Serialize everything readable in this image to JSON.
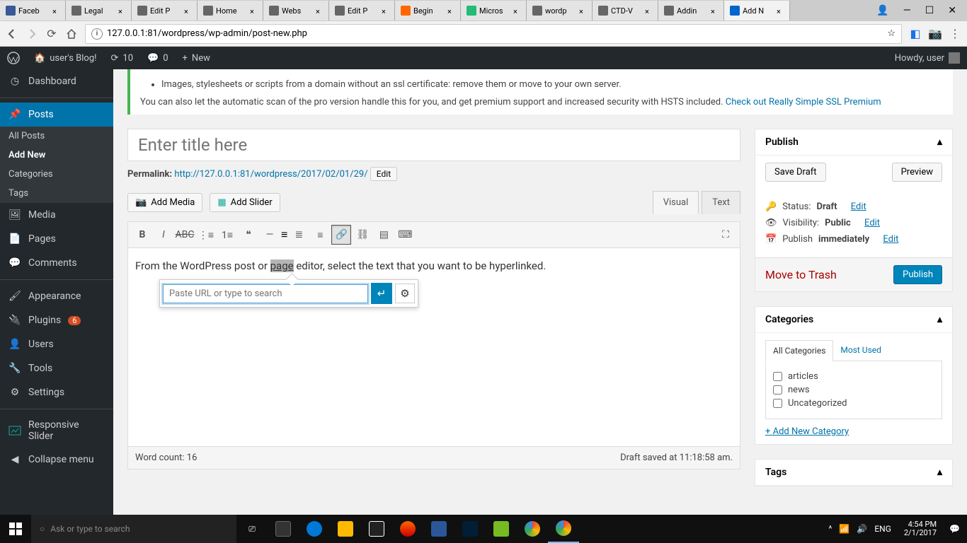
{
  "browser": {
    "tabs": [
      {
        "title": "Faceb"
      },
      {
        "title": "Legal"
      },
      {
        "title": "Edit P"
      },
      {
        "title": "Home"
      },
      {
        "title": "Webs"
      },
      {
        "title": "Edit P"
      },
      {
        "title": "Begin"
      },
      {
        "title": "Micros"
      },
      {
        "title": "wordp"
      },
      {
        "title": "CTD-V"
      },
      {
        "title": "Addin"
      },
      {
        "title": "Add N"
      }
    ],
    "active_tab_index": 11,
    "url": "127.0.0.1:81/wordpress/wp-admin/post-new.php"
  },
  "adminbar": {
    "site_name": "user's Blog!",
    "updates": "10",
    "comments": "0",
    "new": "New",
    "howdy": "Howdy, user"
  },
  "sidebar": {
    "dashboard": "Dashboard",
    "posts": "Posts",
    "posts_sub": {
      "all": "All Posts",
      "add": "Add New",
      "cats": "Categories",
      "tags": "Tags"
    },
    "media": "Media",
    "pages": "Pages",
    "comments": "Comments",
    "appearance": "Appearance",
    "plugins": "Plugins",
    "plugins_count": "6",
    "users": "Users",
    "tools": "Tools",
    "settings": "Settings",
    "responsive_slider": "Responsive Slider",
    "collapse": "Collapse menu"
  },
  "notice": {
    "bullet": "Images, stylesheets or scripts from a domain without an ssl certificate: remove them or move to your own server.",
    "text": "You can also let the automatic scan of the pro version handle this for you, and get premium support and increased security with HSTS included. ",
    "link": "Check out Really Simple SSL Premium"
  },
  "editor": {
    "title_placeholder": "Enter title here",
    "permalink_label": "Permalink: ",
    "permalink_url": "http://127.0.0.1:81/wordpress/2017/02/01/29/",
    "edit_btn": "Edit",
    "add_media": "Add Media",
    "add_slider": "Add Slider",
    "tabs": {
      "visual": "Visual",
      "text": "Text"
    },
    "content_pre": "From the WordPress post or ",
    "content_hl": "page",
    "content_post": " editor, select the text that you want to be hyperlinked.",
    "link_placeholder": "Paste URL or type to search",
    "word_count_label": "Word count: ",
    "word_count": "16",
    "draft_saved": "Draft saved at 11:18:58 am."
  },
  "publish": {
    "title": "Publish",
    "save_draft": "Save Draft",
    "preview": "Preview",
    "status_label": "Status: ",
    "status_value": "Draft",
    "visibility_label": "Visibility: ",
    "visibility_value": "Public",
    "publish_label": "Publish ",
    "publish_value": "immediately",
    "edit": "Edit",
    "trash": "Move to Trash",
    "publish_btn": "Publish"
  },
  "categories": {
    "title": "Categories",
    "tabs": {
      "all": "All Categories",
      "most": "Most Used"
    },
    "items": [
      "articles",
      "news",
      "Uncategorized"
    ],
    "add_new": "+ Add New Category"
  },
  "tags": {
    "title": "Tags"
  },
  "taskbar": {
    "search_placeholder": "Ask or type to search",
    "lang": "ENG",
    "time": "4:54 PM",
    "date": "2/1/2017"
  }
}
